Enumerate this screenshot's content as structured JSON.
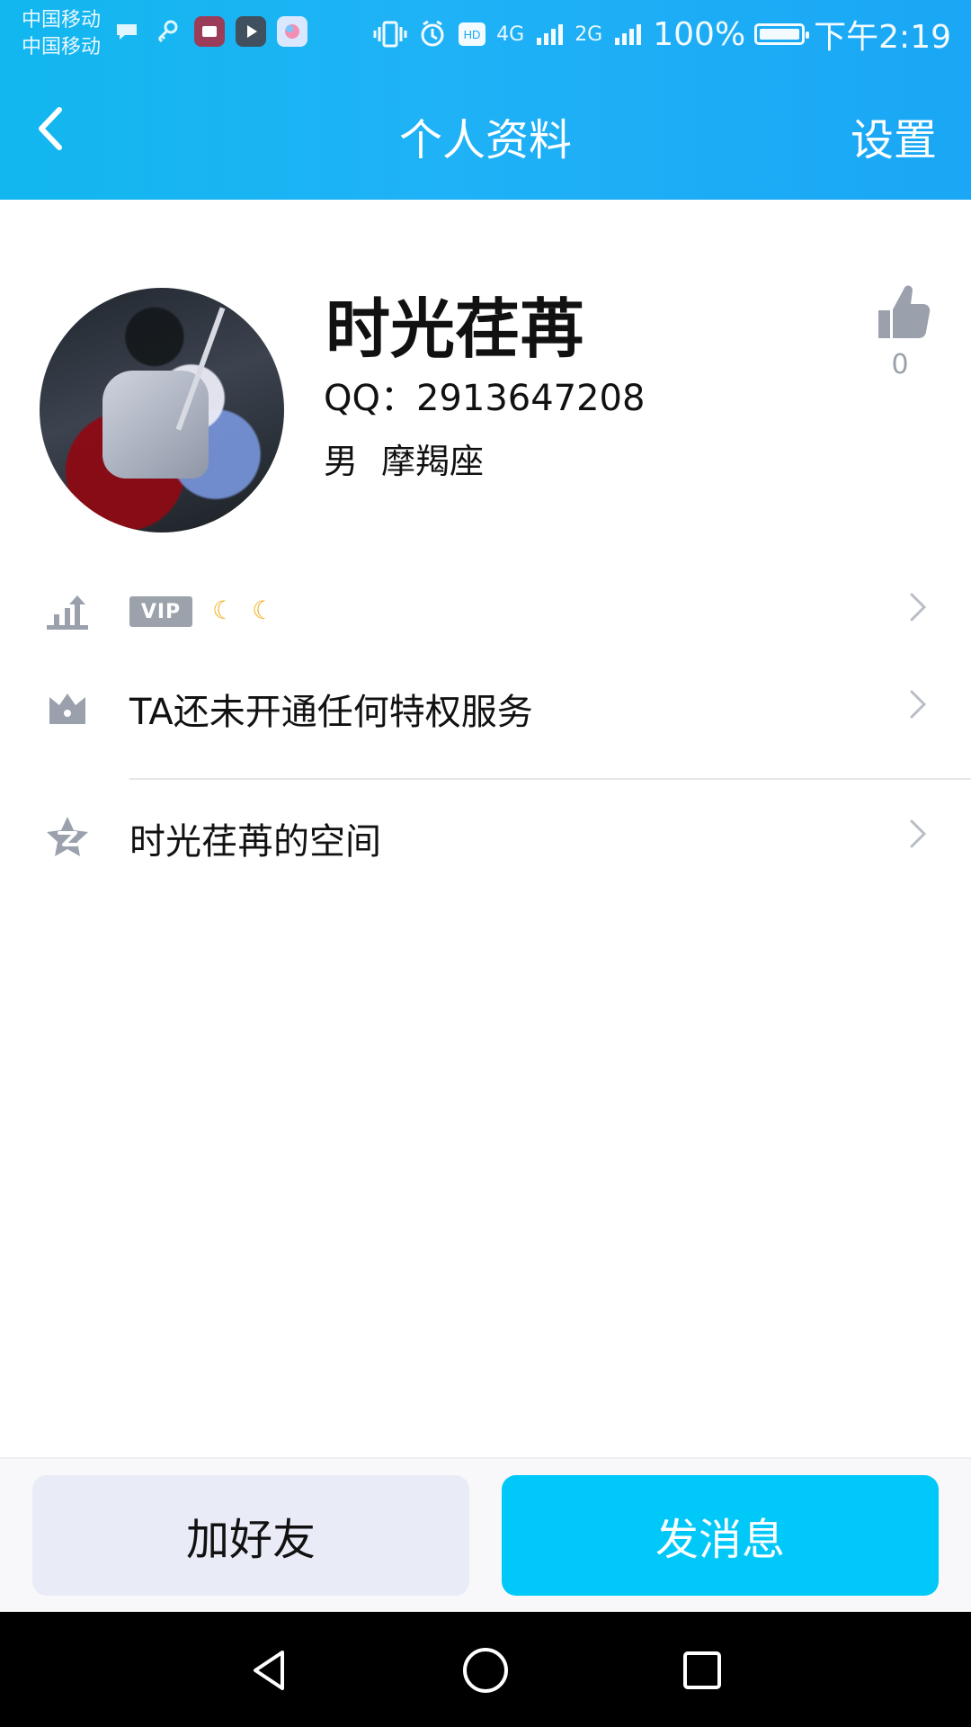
{
  "status_bar": {
    "carrier_1": "中国移动",
    "carrier_2": "中国移动",
    "network_1": "4G",
    "network_2": "2G",
    "battery_text": "100%",
    "battery_level": 1.0,
    "time": "下午2:19"
  },
  "header": {
    "title": "个人资料",
    "settings_label": "设置"
  },
  "profile": {
    "name": "时光荏苒",
    "qq": "QQ：2913647208",
    "gender": "男",
    "zodiac": "摩羯座",
    "likes": "0"
  },
  "list": {
    "vip_badge": "VIP",
    "vip_level_icons": [
      "crescent-moon-icon",
      "crescent-moon-icon"
    ],
    "privilege_text": "TA还未开通任何特权服务",
    "space_text": "时光荏苒的空间"
  },
  "actions": {
    "add_friend": "加好友",
    "send_message": "发消息"
  },
  "colors": {
    "header_blue": "#1fb2f6",
    "primary_button": "#00c8f8",
    "secondary_button": "#e9ecf6",
    "icon_gray": "#9aa1ad"
  }
}
